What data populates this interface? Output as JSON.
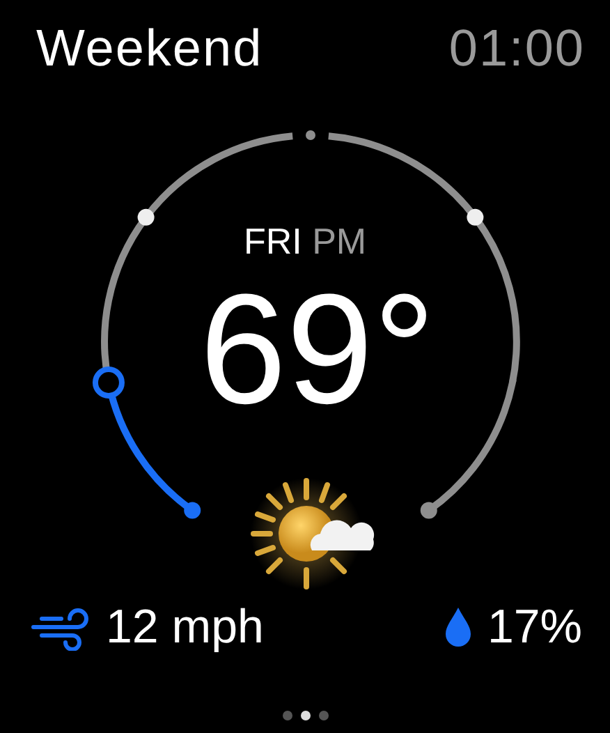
{
  "header": {
    "title": "Weekend",
    "time": "01:00"
  },
  "dial": {
    "day": "FRI",
    "period": "PM",
    "temperature": "69°"
  },
  "wind": {
    "reading": "12 mph"
  },
  "precipitation": {
    "reading": "17%"
  },
  "pages": [
    {
      "selected": false
    },
    {
      "selected": true
    },
    {
      "selected": false
    }
  ]
}
